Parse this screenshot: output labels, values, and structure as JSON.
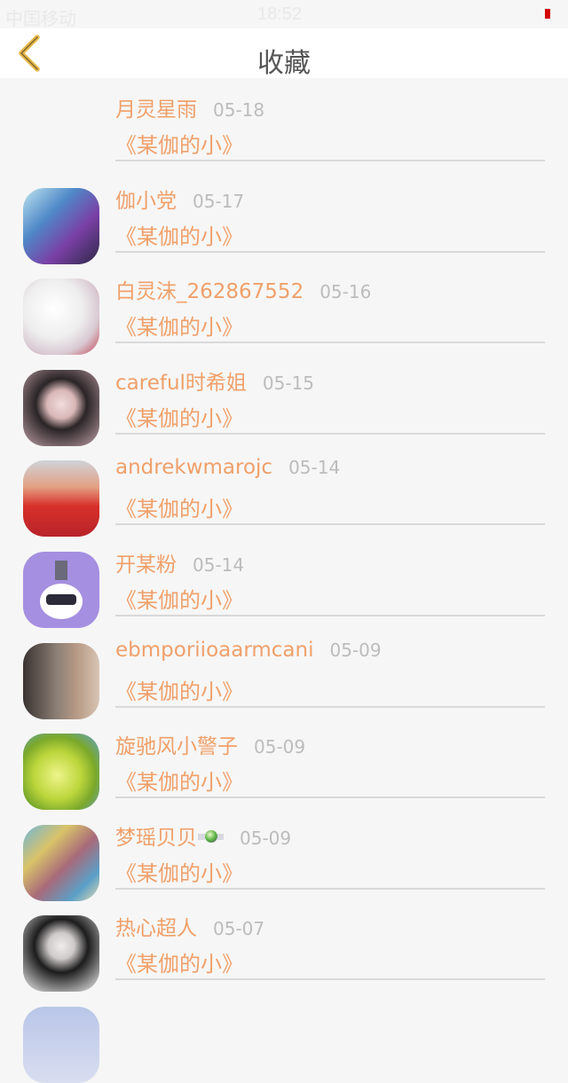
{
  "status": {
    "carrier": "中国移动",
    "time": "18:52"
  },
  "header": {
    "title": "收藏"
  },
  "favorites": [
    {
      "name": "月灵星雨",
      "date": "05-18",
      "work": "《某伽的小》"
    },
    {
      "name": "伽小党",
      "date": "05-17",
      "work": "《某伽的小》"
    },
    {
      "name": "白灵沫_262867552",
      "date": "05-16",
      "work": "《某伽的小》"
    },
    {
      "name": "careful时希姐",
      "date": "05-15",
      "work": "《某伽的小》"
    },
    {
      "name": "andrekwmarojc",
      "date": "05-14",
      "work": "《某伽的小》"
    },
    {
      "name": "开某粉",
      "date": "05-14",
      "work": "《某伽的小》"
    },
    {
      "name": "ebmporiioaarmcani",
      "date": "05-09",
      "work": "《某伽的小》"
    },
    {
      "name": "旋驰风小警子",
      "date": "05-09",
      "work": "《某伽的小》"
    },
    {
      "name": "梦瑶贝贝",
      "date": "05-09",
      "work": "《某伽的小》"
    },
    {
      "name": "热心超人",
      "date": "05-07",
      "work": "《某伽的小》"
    }
  ]
}
